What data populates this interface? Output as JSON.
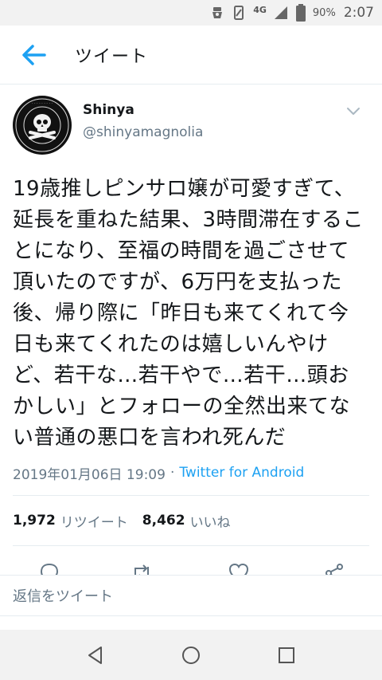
{
  "status_bar": {
    "network": "4G",
    "battery": "90%",
    "time": "2:07"
  },
  "header": {
    "title": "ツイート"
  },
  "tweet": {
    "display_name": "Shinya",
    "handle": "@shinyamagnolia",
    "avatar_ring_text": "SEVERSKULS CHALLENGING TO REALIZE DREAM",
    "text": "19歳推しピンサロ嬢が可愛すぎて、延長を重ねた結果、3時間滞在することになり、至福の時間を過ごさせて頂いたのですが、6万円を支払った後、帰り際に「昨日も来てくれて今日も来てくれたのは嬉しいんやけど、若干な…若干やで…若干…頭おかしい」とフォローの全然出来てない普通の悪口を言われ死んだ",
    "timestamp": "2019年01月06日 19:09",
    "separator": "·",
    "source": "Twitter for Android",
    "retweets_count": "1,972",
    "retweets_label": "リツイート",
    "likes_count": "8,462",
    "likes_label": "いいね"
  },
  "reply": {
    "placeholder": "返信をツイート"
  },
  "colors": {
    "accent": "#1da1f2",
    "secondary_text": "#657786",
    "primary_text": "#14171a",
    "divider": "#e6ecf0"
  }
}
